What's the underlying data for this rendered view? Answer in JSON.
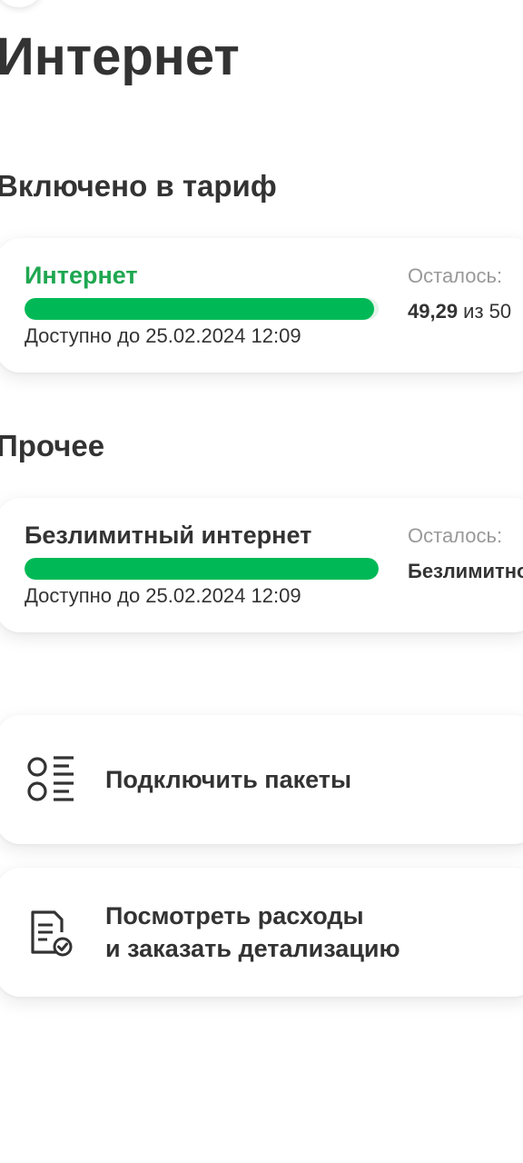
{
  "page": {
    "title": "Интернет"
  },
  "sections": {
    "tariff_title": "Включено в тариф",
    "other_title": "Прочее"
  },
  "tariff_card": {
    "name": "Интернет",
    "date": "Доступно до 25.02.2024 12:09",
    "remaining_label": "Осталось:",
    "remaining_value": "49,29",
    "remaining_total": " из 50",
    "progress_fraction": 0.986,
    "accent_color": "#1fa750"
  },
  "other_card": {
    "name": "Безлимитный интернет",
    "date": "Доступно до 25.02.2024 12:09",
    "remaining_label": "Осталось:",
    "remaining_value": "Безлимитно",
    "progress_fraction": 1.0,
    "accent_color": "#00b956"
  },
  "actions": {
    "packets": {
      "label": "Подключить пакеты",
      "icon": "list-options-icon"
    },
    "expenses": {
      "label_line1": "Посмотреть расходы",
      "label_line2": "и заказать детализацию",
      "icon": "document-check-icon"
    }
  }
}
